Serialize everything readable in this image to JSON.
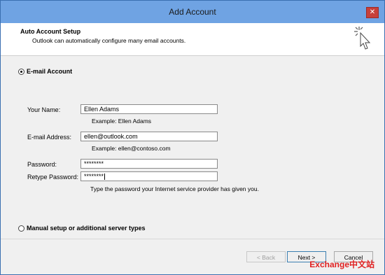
{
  "window": {
    "title": "Add Account",
    "close_glyph": "✕"
  },
  "header": {
    "title": "Auto Account Setup",
    "subtitle": "Outlook can automatically configure many email accounts.",
    "icon": "cursor-click-icon"
  },
  "options": {
    "email_account_label": "E-mail Account",
    "email_account_selected": true,
    "manual_setup_label": "Manual setup or additional server types",
    "manual_setup_selected": false
  },
  "form": {
    "your_name_label": "Your Name:",
    "your_name_value": "Ellen Adams",
    "your_name_example": "Example: Ellen Adams",
    "email_label": "E-mail Address:",
    "email_value": "ellen@outlook.com",
    "email_example": "Example: ellen@contoso.com",
    "password_label": "Password:",
    "password_value": "********",
    "retype_label": "Retype Password:",
    "retype_value": "********",
    "password_hint": "Type the password your Internet service provider has given you."
  },
  "buttons": {
    "back": "< Back",
    "next": "Next >",
    "cancel": "Cancel"
  },
  "watermark": "Exchange中文站",
  "colors": {
    "titlebar": "#6fa3e3",
    "dialog_bg": "#f0f0f0",
    "close": "#c7403a",
    "watermark": "#e02020"
  }
}
